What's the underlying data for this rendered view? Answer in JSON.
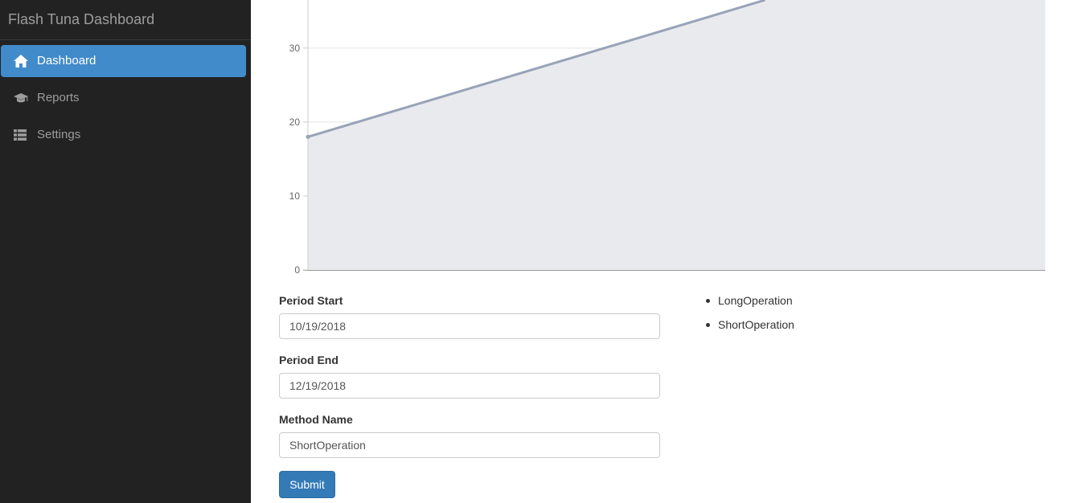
{
  "app": {
    "brand": "Flash Tuna Dashboard"
  },
  "sidebar": {
    "items": [
      {
        "label": "Dashboard",
        "icon": "home-icon",
        "active": true
      },
      {
        "label": "Reports",
        "icon": "graduation-cap-icon",
        "active": false
      },
      {
        "label": "Settings",
        "icon": "list-icon",
        "active": false
      }
    ]
  },
  "colors": {
    "sidebar_bg": "#222222",
    "active_nav": "#428bca",
    "primary_button": "#337ab7",
    "chart_line": "#97a3b8",
    "chart_fill": "#e9eaee"
  },
  "chart_data": {
    "type": "area",
    "title": "",
    "xlabel": "",
    "ylabel": "",
    "ylim": [
      0,
      36.5
    ],
    "yticks": [
      0,
      10,
      20,
      30
    ],
    "ytick_labels": [
      "0",
      "10",
      "20",
      "30"
    ],
    "grid": true,
    "series": [
      {
        "points": [
          {
            "x": 0,
            "y": 18
          },
          {
            "x": 0.62,
            "y": 36.5
          }
        ],
        "marker_at_first": true
      }
    ]
  },
  "form": {
    "period_start": {
      "label": "Period Start",
      "value": "10/19/2018"
    },
    "period_end": {
      "label": "Period End",
      "value": "12/19/2018"
    },
    "method_name": {
      "label": "Method Name",
      "value": "ShortOperation"
    },
    "submit_label": "Submit"
  },
  "methods": [
    "LongOperation",
    "ShortOperation"
  ]
}
